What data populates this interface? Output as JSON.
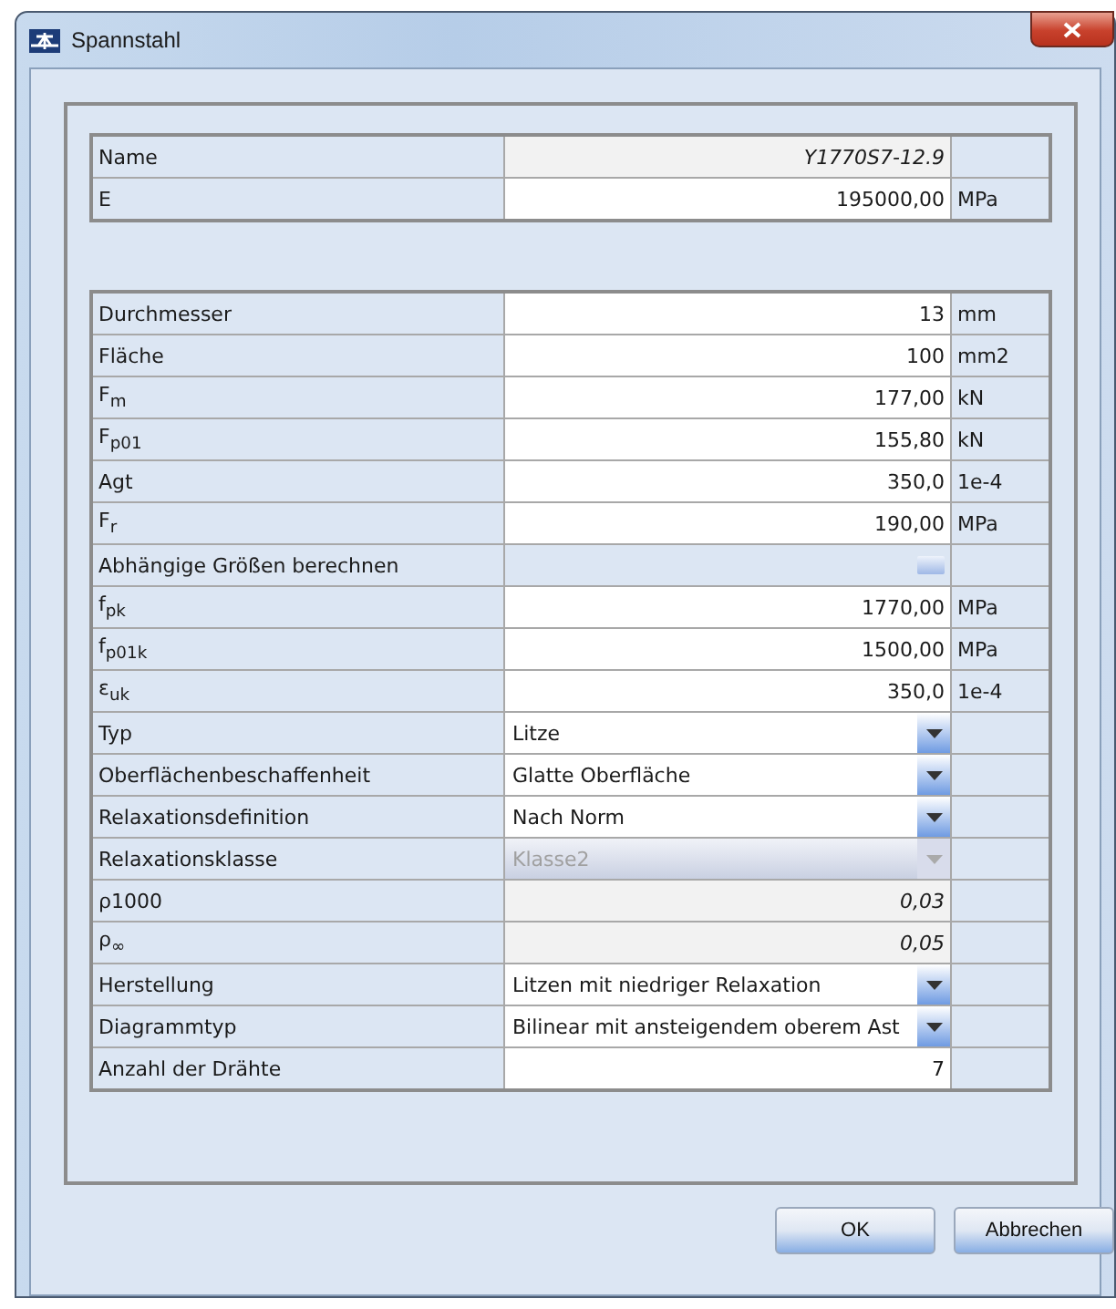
{
  "window": {
    "title": "Spannstahl"
  },
  "header_table": [
    {
      "label": "Name",
      "kind": "readonly",
      "value": "Y1770S7-12.9"
    },
    {
      "label": "E",
      "kind": "number",
      "value": "195000,00",
      "unit": "MPa"
    }
  ],
  "properties": [
    {
      "label": "Durchmesser",
      "kind": "number",
      "value": "13",
      "unit": "mm"
    },
    {
      "label": "Fläche",
      "kind": "number",
      "value": "100",
      "unit": "mm2"
    },
    {
      "label": "F$_{m}$",
      "kind": "number",
      "value": "177,00",
      "unit": "kN"
    },
    {
      "label": "F$_{p01}$",
      "kind": "number",
      "value": "155,80",
      "unit": "kN"
    },
    {
      "label": "Agt",
      "kind": "number",
      "value": "350,0",
      "unit": "1e-4"
    },
    {
      "label": "F$_{r}$",
      "kind": "number",
      "value": "190,00",
      "unit": "MPa"
    },
    {
      "label": "Abhängige Größen berechnen",
      "kind": "checkbox",
      "checked": false
    },
    {
      "label": "f$_{pk}$",
      "kind": "number",
      "value": "1770,00",
      "unit": "MPa"
    },
    {
      "label": "f$_{p01k}$",
      "kind": "number",
      "value": "1500,00",
      "unit": "MPa"
    },
    {
      "label": "ε$_{uk}$",
      "kind": "number",
      "value": "350,0",
      "unit": "1e-4"
    },
    {
      "label": "Typ",
      "kind": "combo",
      "value": "Litze",
      "disabled": false
    },
    {
      "label": "Oberflächenbeschaffenheit",
      "kind": "combo",
      "value": "Glatte Oberfläche",
      "disabled": false
    },
    {
      "label": "Relaxationsdefinition",
      "kind": "combo",
      "value": "Nach Norm",
      "disabled": false
    },
    {
      "label": "Relaxationsklasse",
      "kind": "combo",
      "value": "Klasse2",
      "disabled": true
    },
    {
      "label": "ρ1000",
      "kind": "readonly",
      "value": "0,03"
    },
    {
      "label": "ρ$_{∞}$",
      "kind": "readonly",
      "value": "0,05"
    },
    {
      "label": "Herstellung",
      "kind": "combo",
      "value": "Litzen mit niedriger Relaxation",
      "disabled": false
    },
    {
      "label": "Diagrammtyp",
      "kind": "combo",
      "value": "Bilinear mit ansteigendem oberem Ast",
      "disabled": false
    },
    {
      "label": "Anzahl der Drähte",
      "kind": "number",
      "value": "7"
    }
  ],
  "buttons": [
    "OK",
    "Abbrechen"
  ]
}
